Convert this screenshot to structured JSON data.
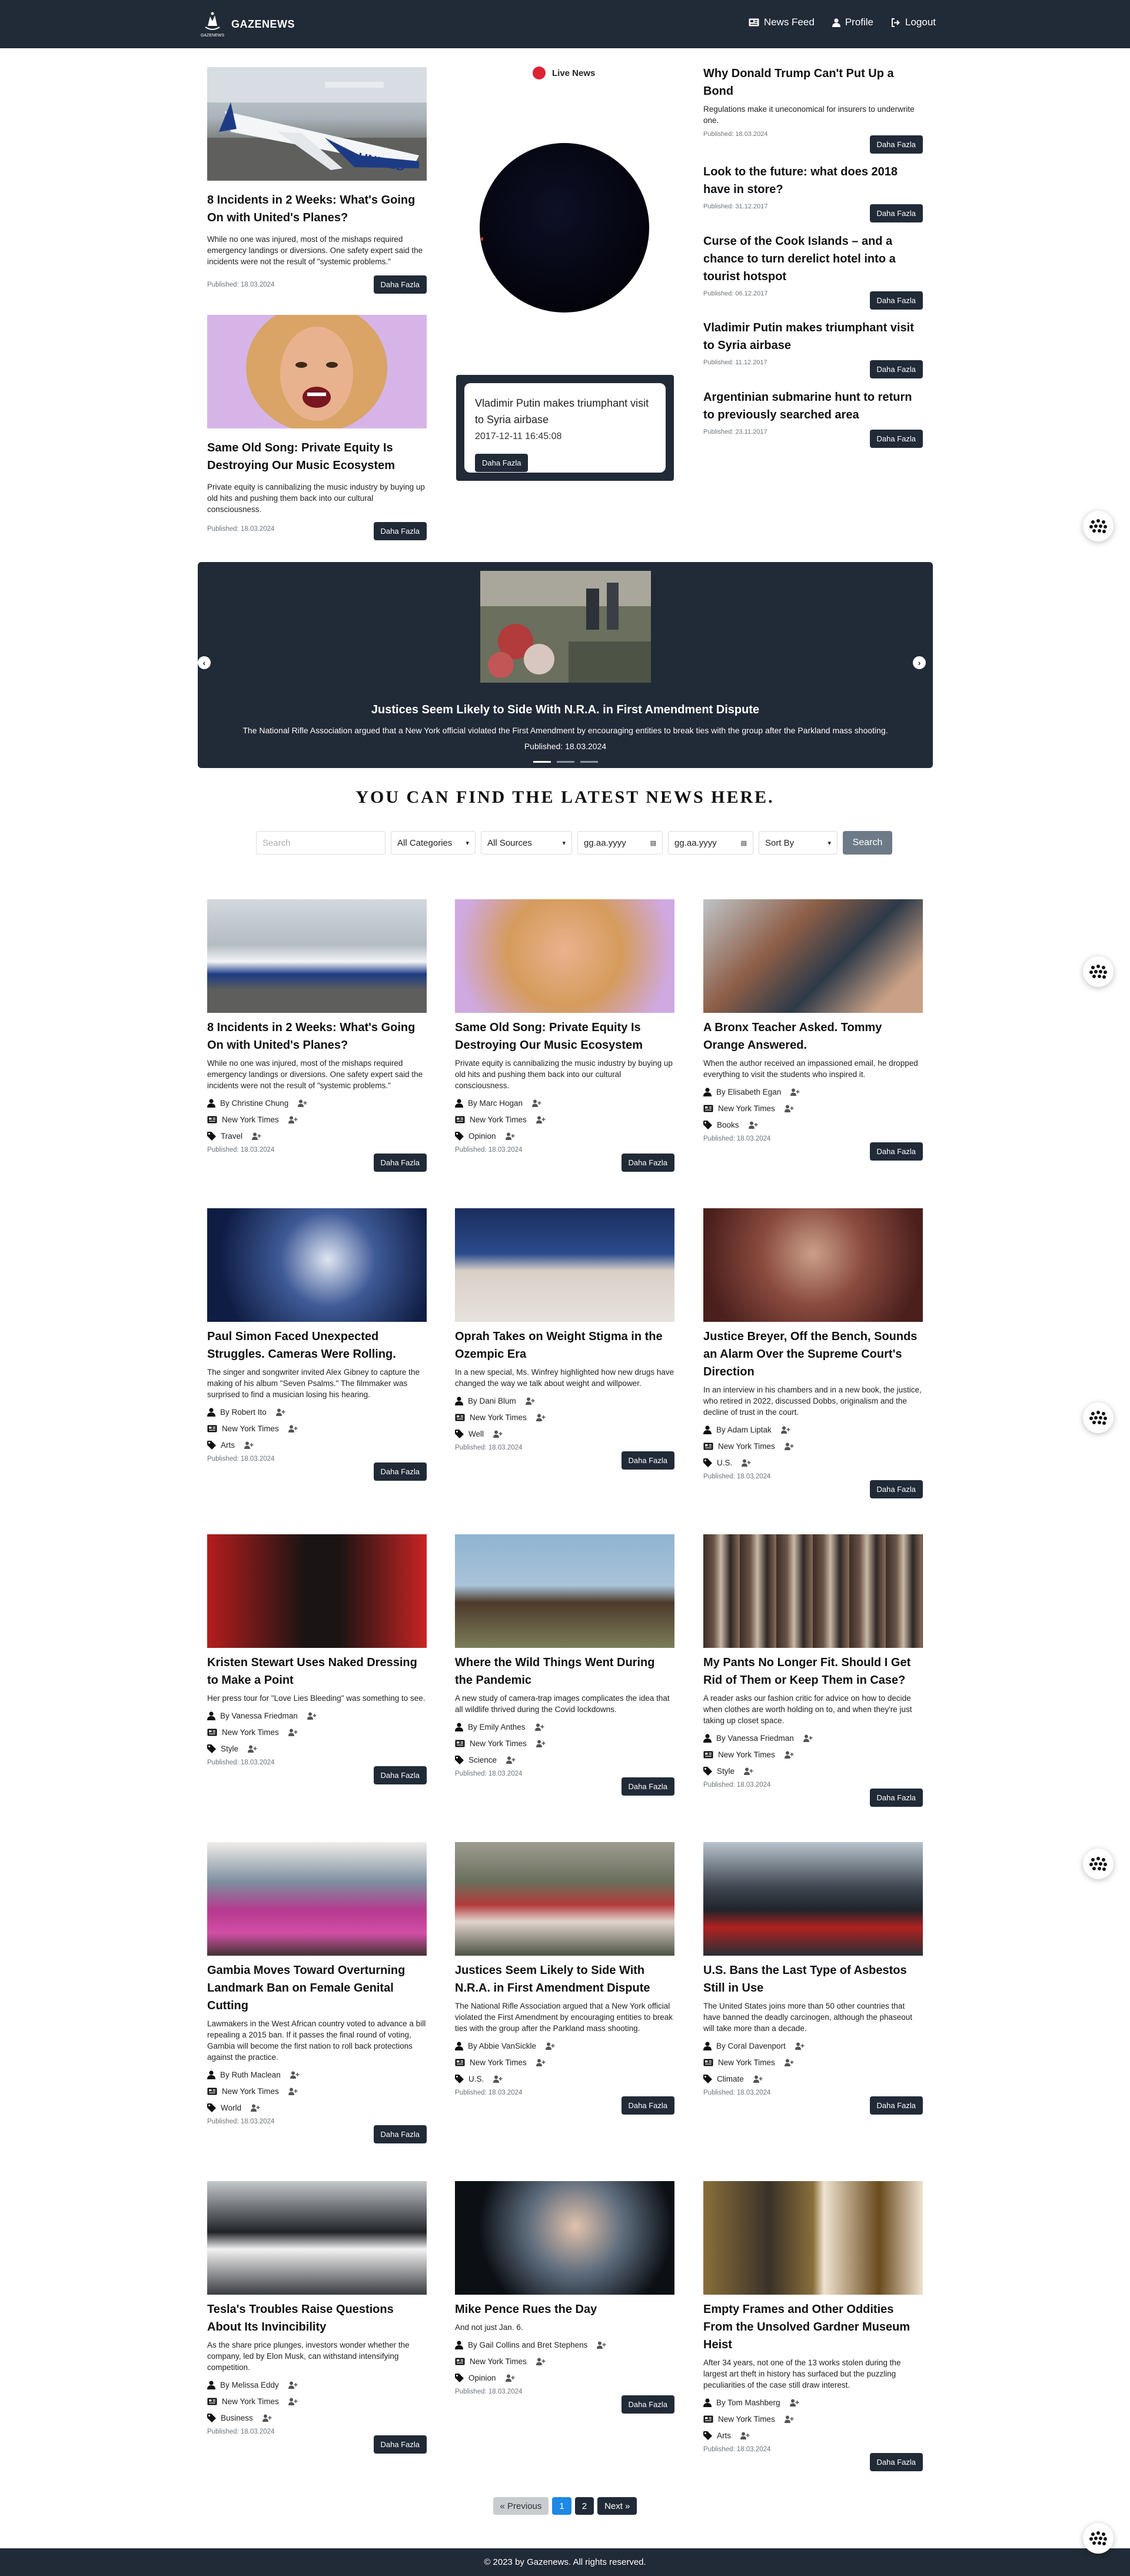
{
  "nav": {
    "brand_mark": "GAZENEWS",
    "brand": "GAZENEWS",
    "links": [
      "News Feed",
      "Profile",
      "Logout"
    ]
  },
  "top_left": [
    {
      "title": "8 Incidents in 2 Weeks: What's Going On with United's Planes?",
      "excerpt": "While no one was injured, most of the mishaps required emergency landings or diversions. One safety expert said the incidents were not the result of \"systemic problems.\"",
      "published": "Published: 18.03.2024",
      "button": "Daha Fazla"
    },
    {
      "title": "Same Old Song: Private Equity Is Destroying Our Music Ecosystem",
      "excerpt": "Private equity is cannibalizing the music industry by buying up old hits and pushing them back into our cultural consciousness.",
      "published": "Published: 18.03.2024",
      "button": "Daha Fazla"
    }
  ],
  "live": {
    "label": "Live News",
    "popup_title": "Vladimir Putin makes triumphant visit to Syria airbase",
    "popup_time": "2017-12-11 16:45:08",
    "popup_button": "Daha Fazla"
  },
  "side_news": [
    {
      "title": "Why Donald Trump Can't Put Up a Bond",
      "excerpt": "Regulations make it uneconomical for insurers to underwrite one.",
      "published": "Published: 18.03.2024",
      "button": "Daha Fazla"
    },
    {
      "title": "Look to the future: what does 2018 have in store?",
      "published": "Published: 31.12.2017",
      "button": "Daha Fazla"
    },
    {
      "title": "Curse of the Cook Islands – and a chance to turn derelict hotel into a tourist hotspot",
      "published": "Published: 06.12.2017",
      "button": "Daha Fazla"
    },
    {
      "title": "Vladimir Putin makes triumphant visit to Syria airbase",
      "published": "Published: 11.12.2017",
      "button": "Daha Fazla"
    },
    {
      "title": "Argentinian submarine hunt to return to previously searched area",
      "published": "Published: 23.11.2017",
      "button": "Daha Fazla"
    }
  ],
  "carousel": {
    "title": "Justices Seem Likely to Side With N.R.A. in First Amendment Dispute",
    "description": "The National Rifle Association argued that a New York official violated the First Amendment by encouraging entities to break ties with the group after the Parkland mass shooting.",
    "published": "Published: 18.03.2024",
    "prev": "‹",
    "next": "›"
  },
  "headline": "YOU CAN FIND THE LATEST NEWS HERE.",
  "filters": {
    "search_placeholder": "Search",
    "categories": "All Categories",
    "sources": "All Sources",
    "date_from": "gg.aa.yyyy",
    "date_to": "gg.aa.yyyy",
    "sort": "Sort By",
    "search_button": "Search"
  },
  "articles": [
    {
      "title": "8 Incidents in 2 Weeks: What's Going On with United's Planes?",
      "excerpt": "While no one was injured, most of the mishaps required emergency landings or diversions. One safety expert said the incidents were not the result of \"systemic problems.\"",
      "author": "By Christine Chung",
      "source": "New York Times",
      "category": "Travel",
      "published": "Published: 18.03.2024",
      "button": "Daha Fazla",
      "image": "plane"
    },
    {
      "title": "Same Old Song: Private Equity Is Destroying Our Music Ecosystem",
      "excerpt": "Private equity is cannibalizing the music industry by buying up old hits and pushing them back into our cultural consciousness.",
      "author": "By Marc Hogan",
      "source": "New York Times",
      "category": "Opinion",
      "published": "Published: 18.03.2024",
      "button": "Daha Fazla",
      "image": "singer"
    },
    {
      "title": "A Bronx Teacher Asked. Tommy Orange Answered.",
      "excerpt": "When the author received an impassioned email, he dropped everything to visit the students who inspired it.",
      "author": "By Elisabeth Egan",
      "source": "New York Times",
      "category": "Books",
      "published": "Published: 18.03.2024",
      "button": "Daha Fazla",
      "image": "classroom"
    },
    {
      "title": "Paul Simon Faced Unexpected Struggles. Cameras Were Rolling.",
      "excerpt": "The singer and songwriter invited Alex Gibney to capture the making of his album \"Seven Psalms.\" The filmmaker was surprised to find a musician losing his hearing.",
      "author": "By Robert Ito",
      "source": "New York Times",
      "category": "Arts",
      "published": "Published: 18.03.2024",
      "button": "Daha Fazla",
      "image": "concert"
    },
    {
      "title": "Oprah Takes on Weight Stigma in the Ozempic Era",
      "excerpt": "In a new special, Ms. Winfrey highlighted how new drugs have changed the way we talk about weight and willpower.",
      "author": "By Dani Blum",
      "source": "New York Times",
      "category": "Well",
      "published": "Published: 18.03.2024",
      "button": "Daha Fazla",
      "image": "talkshow"
    },
    {
      "title": "Justice Breyer, Off the Bench, Sounds an Alarm Over the Supreme Court's Direction",
      "excerpt": "In an interview in his chambers and in a new book, the justice, who retired in 2022, discussed Dobbs, originalism and the decline of trust in the court.",
      "author": "By Adam Liptak",
      "source": "New York Times",
      "category": "U.S.",
      "published": "Published: 18.03.2024",
      "button": "Daha Fazla",
      "image": "portrait"
    },
    {
      "title": "Kristen Stewart Uses Naked Dressing to Make a Point",
      "excerpt": "Her press tour for \"Love Lies Bleeding\" was something to see.",
      "author": "By Vanessa Friedman",
      "source": "New York Times",
      "category": "Style",
      "published": "Published: 18.03.2024",
      "button": "Daha Fazla",
      "image": "redcarpet"
    },
    {
      "title": "Where the Wild Things Went During the Pandemic",
      "excerpt": "A new study of camera-trap images complicates the idea that all wildlife thrived during the Covid lockdowns.",
      "author": "By Emily Anthes",
      "source": "New York Times",
      "category": "Science",
      "published": "Published: 18.03.2024",
      "button": "Daha Fazla",
      "image": "bison"
    },
    {
      "title": "My Pants No Longer Fit. Should I Get Rid of Them or Keep Them in Case?",
      "excerpt": "A reader asks our fashion critic for advice on how to decide when clothes are worth holding on to, and when they're just taking up closet space.",
      "author": "By Vanessa Friedman",
      "source": "New York Times",
      "category": "Style",
      "published": "Published: 18.03.2024",
      "button": "Daha Fazla",
      "image": "closet"
    },
    {
      "title": "Gambia Moves Toward Overturning Landmark Ban on Female Genital Cutting",
      "excerpt": "Lawmakers in the West African country voted to advance a bill repealing a 2015 ban. If it passes the final round of voting, Gambia will become the first nation to roll back protections against the practice.",
      "author": "By Ruth Maclean",
      "source": "New York Times",
      "category": "World",
      "published": "Published: 18.03.2024",
      "button": "Daha Fazla",
      "image": "protest"
    },
    {
      "title": "Justices Seem Likely to Side With N.R.A. in First Amendment Dispute",
      "excerpt": "The National Rifle Association argued that a New York official violated the First Amendment by encouraging entities to break ties with the group after the Parkland mass shooting.",
      "author": "By Abbie VanSickle",
      "source": "New York Times",
      "category": "U.S.",
      "published": "Published: 18.03.2024",
      "button": "Daha Fazla",
      "image": "memorial"
    },
    {
      "title": "U.S. Bans the Last Type of Asbestos Still in Use",
      "excerpt": "The United States joins more than 50 other countries that have banned the deadly carcinogen, although the phaseout will take more than a decade.",
      "author": "By Coral Davenport",
      "source": "New York Times",
      "category": "Climate",
      "published": "Published: 18.03.2024",
      "button": "Daha Fazla",
      "image": "asbestos"
    },
    {
      "title": "Tesla's Troubles Raise Questions About Its Invincibility",
      "excerpt": "As the share price plunges, investors wonder whether the company, led by Elon Musk, can withstand intensifying competition.",
      "author": "By Melissa Eddy",
      "source": "New York Times",
      "category": "Business",
      "published": "Published: 18.03.2024",
      "button": "Daha Fazla",
      "image": "police"
    },
    {
      "title": "Mike Pence Rues the Day",
      "excerpt": "And not just Jan. 6.",
      "author": "By Gail Collins and Bret Stephens",
      "source": "New York Times",
      "category": "Opinion",
      "published": "Published: 18.03.2024",
      "button": "Daha Fazla",
      "image": "pence"
    },
    {
      "title": "Empty Frames and Other Oddities From the Unsolved Gardner Museum Heist",
      "excerpt": "After 34 years, not one of the 13 works stolen during the largest art theft in history has surfaced but the puzzling peculiarities of the case still draw interest.",
      "author": "By Tom Mashberg",
      "source": "New York Times",
      "category": "Arts",
      "published": "Published: 18.03.2024",
      "button": "Daha Fazla",
      "image": "frames"
    }
  ],
  "pagination": {
    "prev": "« Previous",
    "pages": [
      "1",
      "2"
    ],
    "next": "Next »",
    "current": "1"
  },
  "footer": "© 2023 by Gazenews. All rights reserved."
}
